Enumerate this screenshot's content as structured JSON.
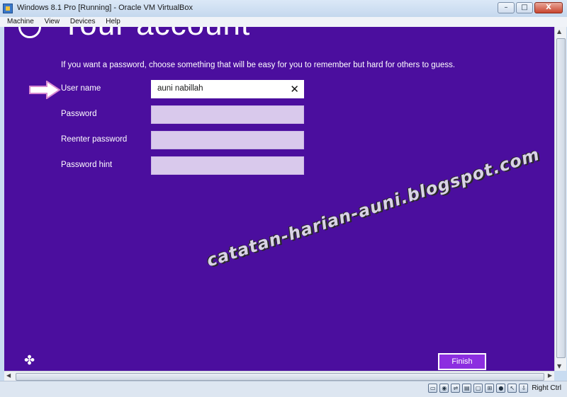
{
  "window": {
    "title": "Windows 8.1 Pro [Running] - Oracle VM VirtualBox",
    "minimize_glyph": "–",
    "maximize_glyph": "□",
    "close_glyph": "X"
  },
  "menu": {
    "items": [
      "Machine",
      "View",
      "Devices",
      "Help"
    ]
  },
  "setup": {
    "title": "Your account",
    "intro": "If you want a password, choose something that will be easy for you to remember but hard for others to guess.",
    "fields": [
      {
        "label": "User name",
        "value": "auni nabillah"
      },
      {
        "label": "Password",
        "value": ""
      },
      {
        "label": "Reenter password",
        "value": ""
      },
      {
        "label": "Password hint",
        "value": ""
      }
    ],
    "clear_glyph": "✕",
    "finish_label": "Finish",
    "ease_of_access_glyph": "✤"
  },
  "watermark": {
    "text": "catatan-harian-auni.blogspot.com"
  },
  "statusbar": {
    "host_key": "Right Ctrl",
    "icons": [
      "hard-disk-icon",
      "optical-drive-icon",
      "usb-icon",
      "shared-folder-icon",
      "display-icon",
      "network-icon",
      "video-capture-icon",
      "mouse-integration-icon",
      "host-key-icon"
    ]
  },
  "colors": {
    "screen_bg": "#4b0e9e",
    "finish_bg": "#8c2ee0",
    "field_bg": "#d9c9ec"
  }
}
